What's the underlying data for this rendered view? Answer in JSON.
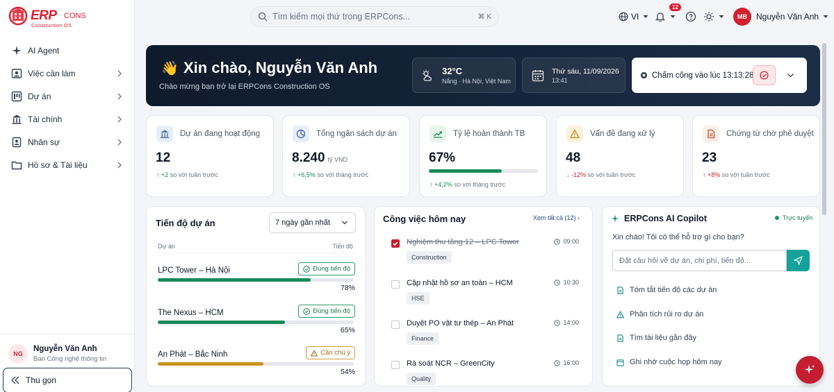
{
  "brand": {
    "logo_main": "ERP",
    "logo_cons": "CONS",
    "logo_sub": "Construction OS"
  },
  "sidebar": {
    "items": [
      {
        "label": "AI Agent",
        "icon": "sparkle-icon",
        "has_submenu": false
      },
      {
        "label": "Việc cần làm",
        "icon": "user-card-icon",
        "has_submenu": true
      },
      {
        "label": "Dự án",
        "icon": "kanban-icon",
        "has_submenu": true
      },
      {
        "label": "Tài chính",
        "icon": "bank-icon",
        "has_submenu": true
      },
      {
        "label": "Nhân sự",
        "icon": "badge-icon",
        "has_submenu": true
      },
      {
        "label": "Hồ sơ & Tài liệu",
        "icon": "folder-icon",
        "has_submenu": true
      }
    ],
    "user": {
      "initials": "NG",
      "name": "Nguyễn Văn Anh",
      "dept": "Ban Công nghệ thông tin"
    },
    "collapse_label": "Thu gọn"
  },
  "topbar": {
    "search_placeholder": "Tìm kiếm mọi thứ trong ERPCons...",
    "shortcut": "⌘ K",
    "language": "VI",
    "notification_count": "12",
    "user_initials": "MB",
    "user_name": "Nguyễn Văn Anh"
  },
  "hero": {
    "greeting": "Xin chào, Nguyễn Văn Anh",
    "wave": "👋",
    "subtitle": "Chào mừng bạn trở lại ERPCons Construction OS",
    "weather_temp": "32°C",
    "weather_desc": "Nắng · Hà Nội, Việt Nam",
    "date": "Thứ sáu, 11/09/2026",
    "time": "13:41",
    "checkin_text": "Chấm công vào lúc 13:13:28"
  },
  "stats": [
    {
      "label": "Dự án đang hoạt động",
      "value": "12",
      "unit": "",
      "delta": "+2",
      "delta_text": "so với tuần trước",
      "direction": "up",
      "icon": "bank-icon",
      "icon_color": "#4b6ea8",
      "icon_bg": "#e8eef8"
    },
    {
      "label": "Tổng ngân sách dự án",
      "value": "8.240",
      "unit": "tỷ VND",
      "delta": "+6,5%",
      "delta_text": "so với tháng trước",
      "direction": "up",
      "icon": "pie-chart-icon",
      "icon_color": "#4b6ea8",
      "icon_bg": "#e8eef8"
    },
    {
      "label": "Tỷ lệ hoàn thành TB",
      "value": "67%",
      "unit": "",
      "delta": "+4,2%",
      "delta_text": "so với tháng trước",
      "direction": "up",
      "progress": 0.67,
      "icon": "trending-up-icon",
      "icon_color": "#1a8a5a",
      "icon_bg": "#e6f4ec"
    },
    {
      "label": "Vấn đề đang xử lý",
      "value": "48",
      "unit": "",
      "delta": "-12%",
      "delta_text": "so với tuần trước",
      "direction": "down",
      "icon": "warning-icon",
      "icon_color": "#c98a10",
      "icon_bg": "#fbf1dc"
    },
    {
      "label": "Chứng từ chờ phê duyệt",
      "value": "23",
      "unit": "",
      "delta": "+8%",
      "delta_text": "so với tuần trước",
      "direction": "up-red",
      "icon": "document-icon",
      "icon_color": "#d0502a",
      "icon_bg": "#fceee8"
    }
  ],
  "progress_panel": {
    "title": "Tiến độ dự án",
    "filter": "7 ngày gần nhất",
    "col_project": "Dự án",
    "col_progress": "Tiến độ",
    "projects": [
      {
        "name": "LPC Tower – Hà Nội",
        "status": "Đúng tiến độ",
        "status_type": "ok",
        "progress": 0.78,
        "pct": "78%",
        "color": "#1a8a5a"
      },
      {
        "name": "The Nexus – HCM",
        "status": "Đúng tiến độ",
        "status_type": "ok",
        "progress": 0.65,
        "pct": "65%",
        "color": "#1a8a5a"
      },
      {
        "name": "An Phát – Bắc Ninh",
        "status": "Cần chú ý",
        "status_type": "warn",
        "progress": 0.54,
        "pct": "54%",
        "color": "#c9921f"
      }
    ]
  },
  "tasks_panel": {
    "title": "Công việc hôm nay",
    "see_all": "Xem tất cả (12)",
    "tasks": [
      {
        "name": "Nghiệm thu tầng 12 – LPC Tower",
        "time": "09:00",
        "tag": "Construction",
        "done": true
      },
      {
        "name": "Cập nhật hồ sơ an toàn – HCM",
        "time": "10:30",
        "tag": "HSE",
        "done": false
      },
      {
        "name": "Duyệt PO vật tư thép – An Phát",
        "time": "14:00",
        "tag": "Finance",
        "done": false
      },
      {
        "name": "Rà soát NCR – GreenCity",
        "time": "16:00",
        "tag": "Quality",
        "done": false
      }
    ]
  },
  "copilot": {
    "title": "ERPCons AI Copilot",
    "status": "Trực tuyến",
    "greeting": "Xin chào! Tôi có thể hỗ trợ gì cho bạn?",
    "input_placeholder": "Đặt câu hỏi về dự án, chi phí, tiến độ...",
    "suggestions": [
      {
        "label": "Tóm tắt tiến độ các dự án",
        "icon": "document-icon"
      },
      {
        "label": "Phân tích rủi ro dự án",
        "icon": "warning-icon"
      },
      {
        "label": "Tìm tài liệu gần đây",
        "icon": "document-icon"
      },
      {
        "label": "Ghi nhớ cuộc họp hôm nay",
        "icon": "calendar-icon"
      }
    ]
  }
}
